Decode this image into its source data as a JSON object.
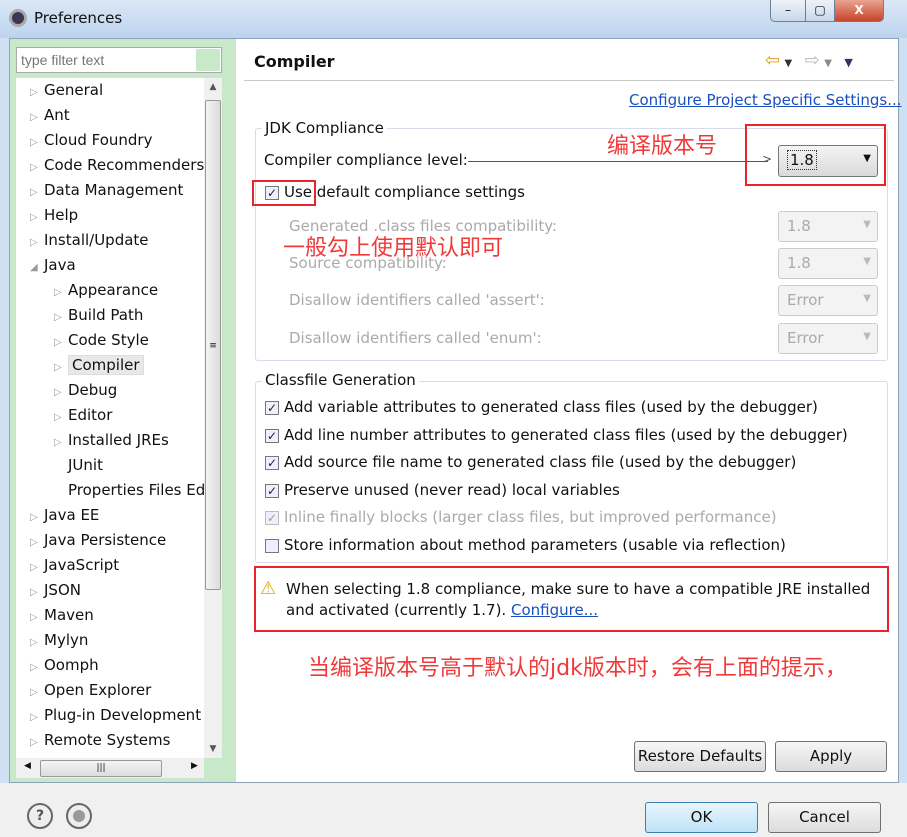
{
  "window": {
    "title": "Preferences",
    "min": "–",
    "max": "▢",
    "close": "X"
  },
  "filter": {
    "placeholder": "type filter text"
  },
  "tree": [
    {
      "label": "General",
      "level": 0,
      "arrow": true
    },
    {
      "label": "Ant",
      "level": 0,
      "arrow": true
    },
    {
      "label": "Cloud Foundry",
      "level": 0,
      "arrow": true
    },
    {
      "label": "Code Recommenders",
      "level": 0,
      "arrow": true
    },
    {
      "label": "Data Management",
      "level": 0,
      "arrow": true
    },
    {
      "label": "Help",
      "level": 0,
      "arrow": true
    },
    {
      "label": "Install/Update",
      "level": 0,
      "arrow": true
    },
    {
      "label": "Java",
      "level": 0,
      "arrow": true,
      "expanded": true
    },
    {
      "label": "Appearance",
      "level": 1,
      "arrow": true
    },
    {
      "label": "Build Path",
      "level": 1,
      "arrow": true
    },
    {
      "label": "Code Style",
      "level": 1,
      "arrow": true
    },
    {
      "label": "Compiler",
      "level": 1,
      "arrow": true,
      "selected": true
    },
    {
      "label": "Debug",
      "level": 1,
      "arrow": true
    },
    {
      "label": "Editor",
      "level": 1,
      "arrow": true
    },
    {
      "label": "Installed JREs",
      "level": 1,
      "arrow": true
    },
    {
      "label": "JUnit",
      "level": 1,
      "arrow": false
    },
    {
      "label": "Properties Files Ed",
      "level": 1,
      "arrow": false
    },
    {
      "label": "Java EE",
      "level": 0,
      "arrow": true
    },
    {
      "label": "Java Persistence",
      "level": 0,
      "arrow": true
    },
    {
      "label": "JavaScript",
      "level": 0,
      "arrow": true
    },
    {
      "label": "JSON",
      "level": 0,
      "arrow": true
    },
    {
      "label": "Maven",
      "level": 0,
      "arrow": true
    },
    {
      "label": "Mylyn",
      "level": 0,
      "arrow": true
    },
    {
      "label": "Oomph",
      "level": 0,
      "arrow": true
    },
    {
      "label": "Open Explorer",
      "level": 0,
      "arrow": true
    },
    {
      "label": "Plug-in Development",
      "level": 0,
      "arrow": true
    },
    {
      "label": "Remote Systems",
      "level": 0,
      "arrow": true
    }
  ],
  "page": {
    "title": "Compiler",
    "configure_link": "Configure Project Specific Settings..."
  },
  "jdk": {
    "group_label": "JDK Compliance",
    "level_label": "Compiler compliance level:",
    "level_value": "1.8",
    "use_default_label": "Use default compliance settings",
    "use_default_checked": true,
    "rows": [
      {
        "label": "Generated .class files compatibility:",
        "value": "1.8"
      },
      {
        "label": "Source compatibility:",
        "value": "1.8"
      },
      {
        "label": "Disallow identifiers called 'assert':",
        "value": "Error"
      },
      {
        "label": "Disallow identifiers called 'enum':",
        "value": "Error"
      }
    ]
  },
  "classfile": {
    "group_label": "Classfile Generation",
    "options": [
      {
        "label": "Add variable attributes to generated class files (used by the debugger)",
        "checked": true,
        "disabled": false
      },
      {
        "label": "Add line number attributes to generated class files (used by the debugger)",
        "checked": true,
        "disabled": false
      },
      {
        "label": "Add source file name to generated class file (used by the debugger)",
        "checked": true,
        "disabled": false
      },
      {
        "label": "Preserve unused (never read) local variables",
        "checked": true,
        "disabled": false
      },
      {
        "label": "Inline finally blocks (larger class files, but improved performance)",
        "checked": true,
        "disabled": true
      },
      {
        "label": "Store information about method parameters (usable via reflection)",
        "checked": false,
        "disabled": false
      }
    ]
  },
  "warning": {
    "text": "When selecting 1.8 compliance, make sure to have a compatible JRE installed and activated (currently 1.7).",
    "link": "Configure..."
  },
  "annotations": {
    "version": "编译版本号",
    "default": "一般勾上使用默认即可",
    "hint": "当编译版本号高于默认的jdk版本时，会有上面的提示，"
  },
  "buttons": {
    "restore": "Restore Defaults",
    "apply": "Apply",
    "ok": "OK",
    "cancel": "Cancel",
    "help": "?"
  },
  "colors": {
    "annotation": "#e8252a",
    "link": "#1a4fbf",
    "sidebar": "#c7e8c9"
  }
}
